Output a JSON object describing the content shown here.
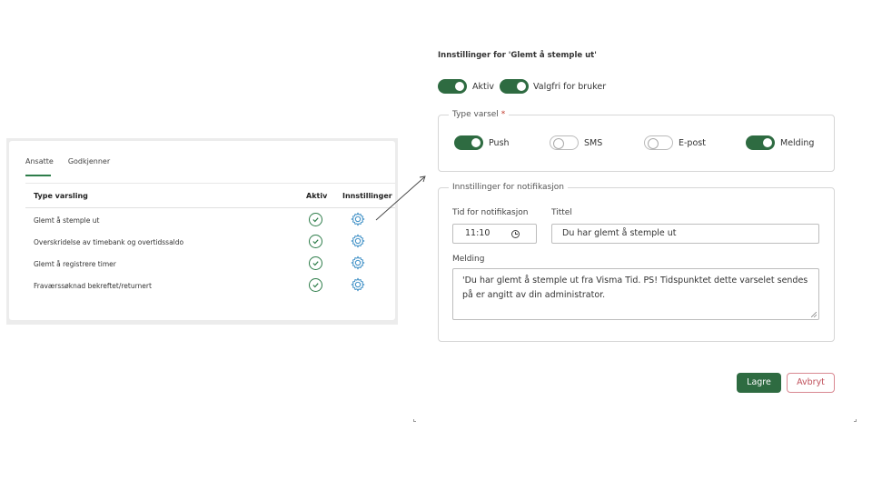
{
  "left_panel": {
    "tabs": [
      {
        "label": "Ansatte",
        "active": true
      },
      {
        "label": "Godkjenner",
        "active": false
      }
    ],
    "columns": {
      "type": "Type varsling",
      "active": "Aktiv",
      "settings": "Innstillinger"
    },
    "rows": [
      {
        "label": "Glemt å stemple ut",
        "active": true
      },
      {
        "label": "Overskridelse av timebank og overtidssaldo",
        "active": true
      },
      {
        "label": "Glemt å registrere timer",
        "active": true
      },
      {
        "label": "Fraværssøknad bekreftet/returnert",
        "active": true
      }
    ],
    "icons": {
      "active": "check-circle-icon",
      "settings": "gear-icon"
    }
  },
  "settings": {
    "title": "Innstillinger for 'Glemt å stemple ut'",
    "toggles": [
      {
        "label": "Aktiv",
        "on": true
      },
      {
        "label": "Valgfri for bruker",
        "on": true
      }
    ],
    "type_group": {
      "legend": "Type varsel",
      "required_mark": "*",
      "options": [
        {
          "label": "Push",
          "on": true
        },
        {
          "label": "SMS",
          "on": false
        },
        {
          "label": "E-post",
          "on": false
        },
        {
          "label": "Melding",
          "on": true
        }
      ]
    },
    "notification_group": {
      "legend": "Innstillinger for notifikasjon",
      "time_label": "Tid for notifikasjon",
      "time_value": "11:10",
      "title_label": "Tittel",
      "title_value": "Du har glemt å stemple ut",
      "message_label": "Melding",
      "message_value": "'Du har glemt å stemple ut fra Visma Tid. PS! Tidspunktet dette varselet sendes på er angitt av din administrator."
    },
    "buttons": {
      "save": "Lagre",
      "cancel": "Avbryt"
    }
  },
  "colors": {
    "accent": "#2e6b41",
    "cancel": "#c0505b"
  }
}
